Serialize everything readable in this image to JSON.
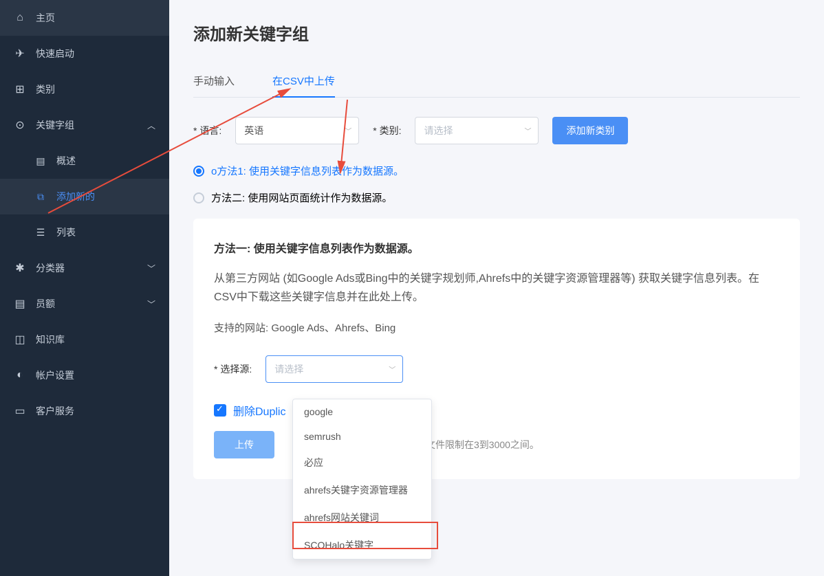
{
  "sidebar": {
    "items": [
      {
        "label": "主页",
        "icon": "⌂"
      },
      {
        "label": "快速启动",
        "icon": "✈"
      },
      {
        "label": "类别",
        "icon": "⊞"
      },
      {
        "label": "关键字组",
        "icon": "🔍"
      },
      {
        "label": "概述",
        "icon": "▤"
      },
      {
        "label": "添加新的",
        "icon": "⧉"
      },
      {
        "label": "列表",
        "icon": "☰"
      },
      {
        "label": "分类器",
        "icon": "✱"
      },
      {
        "label": "员额",
        "icon": "▤"
      },
      {
        "label": "知识库",
        "icon": "◫"
      },
      {
        "label": "帐户设置",
        "icon": "◐"
      },
      {
        "label": "客户服务",
        "icon": "▭"
      }
    ]
  },
  "page_title": "添加新关键字组",
  "tabs": {
    "manual": "手动输入",
    "csv": "在CSV中上传"
  },
  "form": {
    "language_label": "语言:",
    "language_value": "英语",
    "category_label": "类别:",
    "category_placeholder": "请选择",
    "add_category_btn": "添加新类别"
  },
  "methods": {
    "method1": "o方法1: 使用关键字信息列表作为数据源。",
    "method2": "方法二: 使用网站页面统计作为数据源。"
  },
  "panel": {
    "title": "方法一: 使用关键字信息列表作为数据源。",
    "desc": "从第三方网站 (如Google Ads或Bing中的关键字规划师,Ahrefs中的关键字资源管理器等) 获取关键字信息列表。在CSV中下载这些关键字信息并在此处上传。",
    "supported": "支持的网站: Google Ads、Ahrefs、Bing",
    "source_label": "选择源:",
    "source_placeholder": "请选择",
    "checkbox_label": "删除Duplic",
    "upload_btn": "上传",
    "hint": "文件限制在3到3000之间。"
  },
  "dropdown_options": [
    "google",
    "semrush",
    "必应",
    "ahrefs关键字资源管理器",
    "ahrefs网站关键词",
    "SCOHalo关键字"
  ]
}
